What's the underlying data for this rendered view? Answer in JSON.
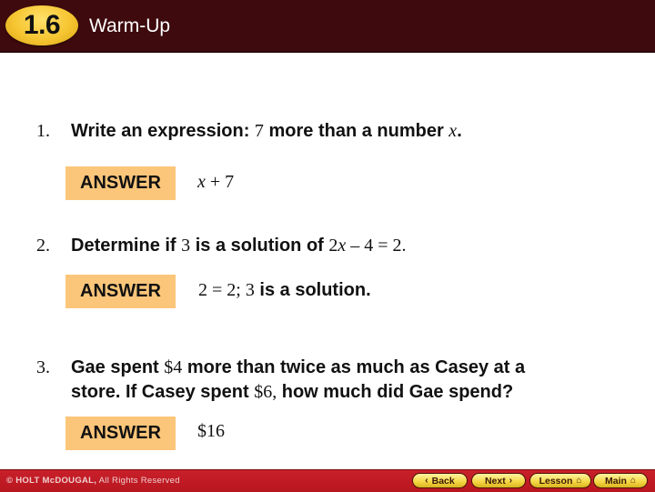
{
  "header": {
    "section_number": "1.6",
    "title": "Warm-Up"
  },
  "questions": [
    {
      "number": "1.",
      "text_parts": [
        "Write an expression: ",
        "7",
        " more than a number ",
        "x",
        "."
      ],
      "answer_label": "ANSWER",
      "answer": "x + 7",
      "answer_parts": [
        "x",
        " + 7"
      ]
    },
    {
      "number": "2.",
      "text_parts": [
        "Determine if ",
        "3",
        " is a solution of ",
        "2",
        "x",
        " – 4 = 2."
      ],
      "answer_label": "ANSWER",
      "answer": "2 = 2; 3 is a solution.",
      "answer_parts": [
        "2 = 2; 3",
        " is a solution."
      ]
    },
    {
      "number": "3.",
      "text_parts": [
        "Gae spent ",
        "$4",
        " more than twice as much as Casey at a",
        "store. If Casey spent ",
        "$6,",
        " how much did Gae spend?"
      ],
      "answer_label": "ANSWER",
      "answer": "$16"
    }
  ],
  "footer": {
    "copyright_bold": "© HOLT McDOUGAL,",
    "copyright_rest": " All Rights Reserved",
    "nav": [
      {
        "label": "Back",
        "icon": "chevron-left-icon",
        "glyph": "‹"
      },
      {
        "label": "Next",
        "icon": "chevron-right-icon",
        "glyph": "›"
      },
      {
        "label": "Lesson",
        "icon": "home-icon",
        "glyph": "⌂"
      },
      {
        "label": "Main",
        "icon": "home-icon",
        "glyph": "⌂"
      }
    ]
  },
  "colors": {
    "header_bg": "#3e0a0d",
    "badge": "#f6c531",
    "answer_bg": "#fcc67a",
    "footer_bg": "#c8202a",
    "nav_button": "#f4d542"
  }
}
